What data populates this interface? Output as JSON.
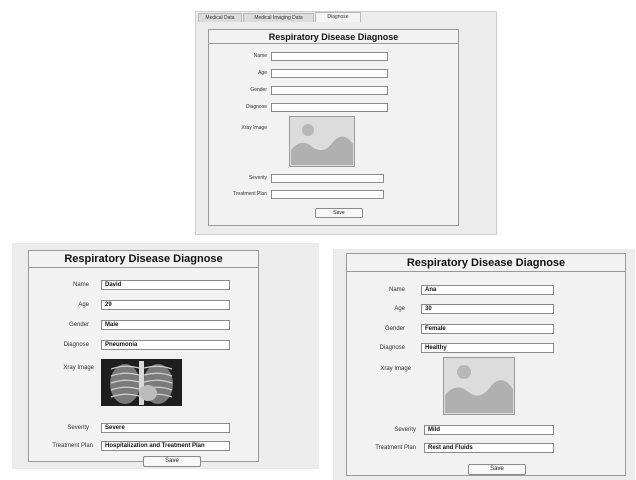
{
  "tabs": [
    {
      "label": "Medical Data"
    },
    {
      "label": "Medical Imaging Data"
    },
    {
      "label": "Diagnose"
    }
  ],
  "form": {
    "title": "Respiratory Disease Diagnose",
    "labels": {
      "name": "Name",
      "age": "Age",
      "gender": "Gender",
      "diagnose": "Diagnose",
      "xray": "Xray Image",
      "severity": "Severity",
      "treatment": "Treatment Plan"
    },
    "save_label": "Save"
  },
  "screens": [
    {
      "name": "",
      "age": "",
      "gender": "",
      "diagnose": "",
      "xray": "placeholder-image-icon",
      "severity": "",
      "treatment": ""
    },
    {
      "name": "David",
      "age": "29",
      "gender": "Male",
      "diagnose": "Pneumonia",
      "xray": "chest-xray-image",
      "severity": "Severe",
      "treatment": "Hospitalization and Treatment Plan"
    },
    {
      "name": "Ana",
      "age": "30",
      "gender": "Female",
      "diagnose": "Healthy",
      "xray": "placeholder-image-icon",
      "severity": "Mild",
      "treatment": "Rest and Fluids"
    }
  ],
  "colors": {
    "window_bg": "#ececec",
    "panel_bg": "#f2f2f2",
    "field_bg": "#ffffff",
    "border": "#8a8a8a",
    "placeholder_tile": "#d9d9d9"
  }
}
